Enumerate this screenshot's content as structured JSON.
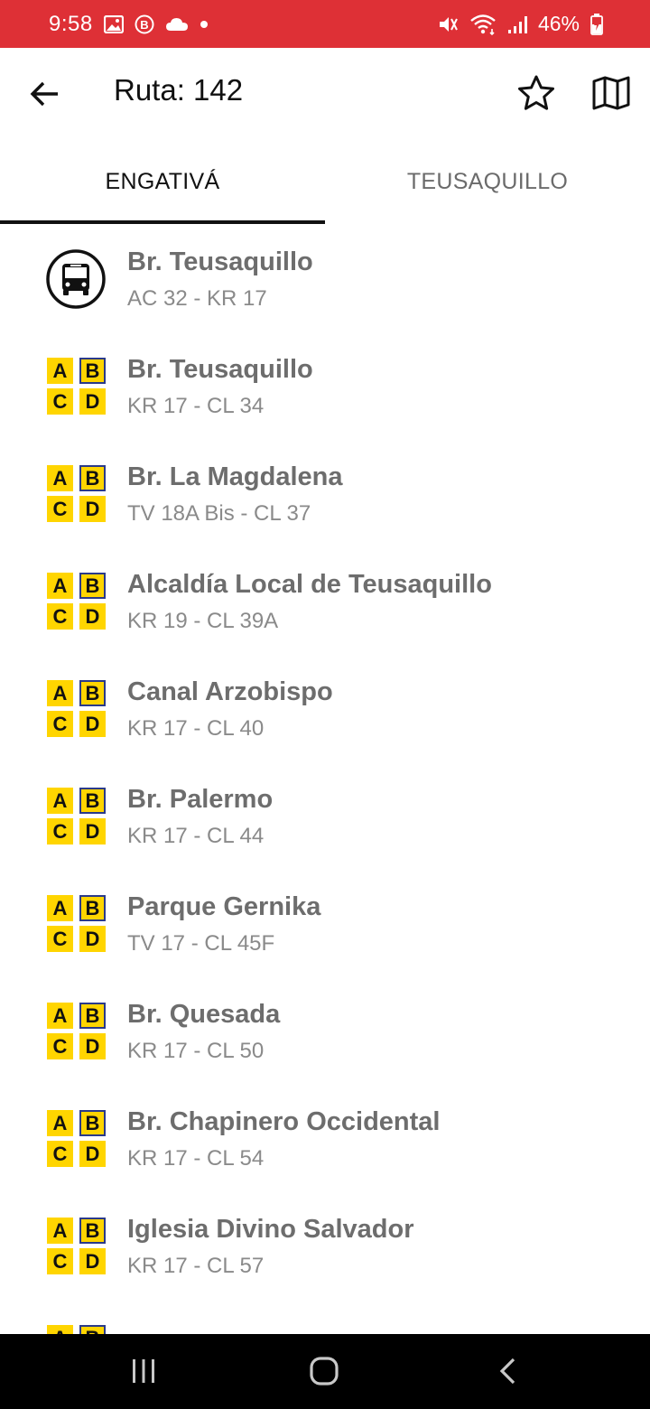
{
  "status_bar": {
    "time": "9:58",
    "battery": "46%",
    "icons": [
      "image-icon",
      "b-circle-icon",
      "cloud-icon",
      "dot-icon",
      "mute-icon",
      "wifi-icon",
      "signal-icon",
      "battery-charging-icon"
    ]
  },
  "app_bar": {
    "title": "Ruta: 142",
    "icons": [
      "back-arrow-icon",
      "star-outline-icon",
      "map-icon"
    ]
  },
  "tabs": [
    {
      "label": "ENGATIVÁ",
      "selected": true
    },
    {
      "label": "TEUSAQUILLO",
      "selected": false
    }
  ],
  "stops": [
    {
      "icon": "bus-icon",
      "name": "Br. Teusaquillo",
      "address": "AC 32 - KR 17"
    },
    {
      "icon": "abcd-icon",
      "name": "Br. Teusaquillo",
      "address": "KR 17 - CL 34"
    },
    {
      "icon": "abcd-icon",
      "name": "Br. La Magdalena",
      "address": "TV 18A Bis - CL 37"
    },
    {
      "icon": "abcd-icon",
      "name": "Alcaldía Local de Teusaquillo",
      "address": "KR 19 - CL 39A"
    },
    {
      "icon": "abcd-icon",
      "name": "Canal Arzobispo",
      "address": "KR 17 - CL 40"
    },
    {
      "icon": "abcd-icon",
      "name": "Br. Palermo",
      "address": "KR 17 - CL 44"
    },
    {
      "icon": "abcd-icon",
      "name": "Parque Gernika",
      "address": "TV 17 - CL 45F"
    },
    {
      "icon": "abcd-icon",
      "name": "Br. Quesada",
      "address": "KR 17 - CL 50"
    },
    {
      "icon": "abcd-icon",
      "name": "Br. Chapinero Occidental",
      "address": "KR 17 - CL 54"
    },
    {
      "icon": "abcd-icon",
      "name": "Iglesia Divino Salvador",
      "address": "KR 17 - CL 57"
    }
  ],
  "abcd_letters": [
    "A",
    "B",
    "C",
    "D"
  ],
  "nav_bar": {
    "icons": [
      "recents-icon",
      "home-icon",
      "back-icon"
    ]
  },
  "colors": {
    "status_bar": "#de3036",
    "stop_name": "#6d6d6d",
    "stop_address": "#8a8a8a",
    "abcd_yellow": "#ffd500",
    "tab_indicator": "#111111"
  }
}
